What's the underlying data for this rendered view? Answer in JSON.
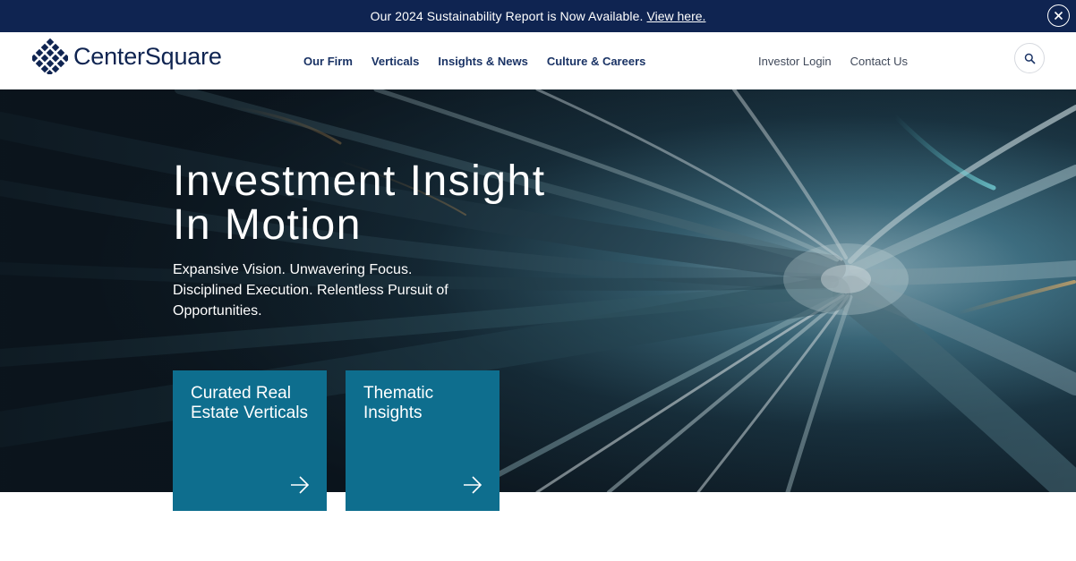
{
  "announcement": {
    "message": "Our 2024 Sustainability Report is Now Available.",
    "link_label": "View here.",
    "close_icon": "close-icon"
  },
  "header": {
    "logo_text": "CenterSquare",
    "logo_icon": "diamond-grid-logo",
    "nav_main": [
      {
        "label": "Our Firm"
      },
      {
        "label": "Verticals"
      },
      {
        "label": "Insights & News"
      },
      {
        "label": "Culture & Careers"
      }
    ],
    "nav_util": [
      {
        "label": "Investor Login"
      },
      {
        "label": "Contact Us"
      }
    ],
    "search_icon": "search-icon"
  },
  "hero": {
    "title_line1": "Investment Insight",
    "title_line2": "In Motion",
    "subtitle": "Expansive Vision. Unwavering Focus. Disciplined Execution. Relentless Pursuit of Opportunities."
  },
  "cards": [
    {
      "title": "Curated Real Estate Verticals",
      "icon": "arrow-right-icon"
    },
    {
      "title": "Thematic Insights",
      "icon": "arrow-right-icon"
    }
  ],
  "colors": {
    "navy": "#0f2451",
    "teal_card": "#0e6e8e",
    "nav_text": "#1a3365"
  }
}
